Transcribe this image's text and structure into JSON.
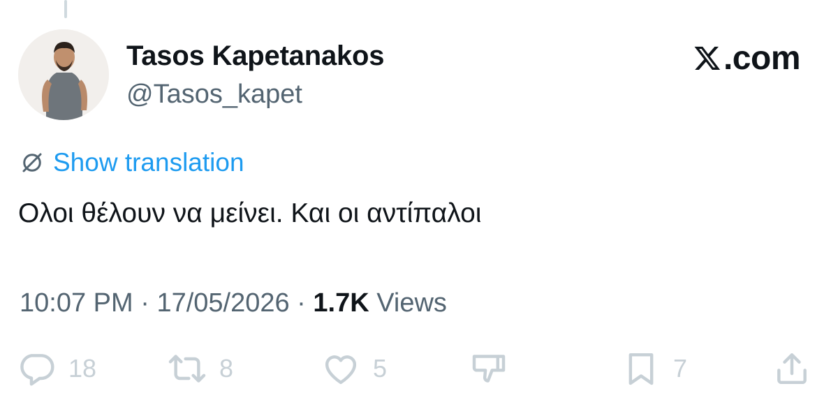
{
  "colors": {
    "link": "#1d9bf0",
    "secondary_text": "#536471",
    "primary_text": "#0f1419",
    "action_icons": "#c7d0d6"
  },
  "author": {
    "display_name": "Tasos Kapetanakos",
    "handle": "@Tasos_kapet"
  },
  "brand": {
    "logo_text": ".com",
    "logo_icon": "x-icon"
  },
  "translation": {
    "icon": "globe-icon",
    "label": "Show translation"
  },
  "tweet": {
    "text": "Ολοι θέλουν να μείνει. Και οι αντίπαλοι"
  },
  "meta": {
    "time": "10:07 PM",
    "separator": " · ",
    "date": "17/05/2026",
    "views_count": "1.7K",
    "views_label": " Views"
  },
  "actions": {
    "reply": {
      "icon": "reply-icon",
      "count": "18"
    },
    "retweet": {
      "icon": "retweet-icon",
      "count": "8"
    },
    "like": {
      "icon": "heart-icon",
      "count": "5"
    },
    "dislike": {
      "icon": "dislike-icon"
    },
    "bookmark": {
      "icon": "bookmark-icon",
      "count": "7"
    },
    "share": {
      "icon": "share-icon"
    }
  }
}
